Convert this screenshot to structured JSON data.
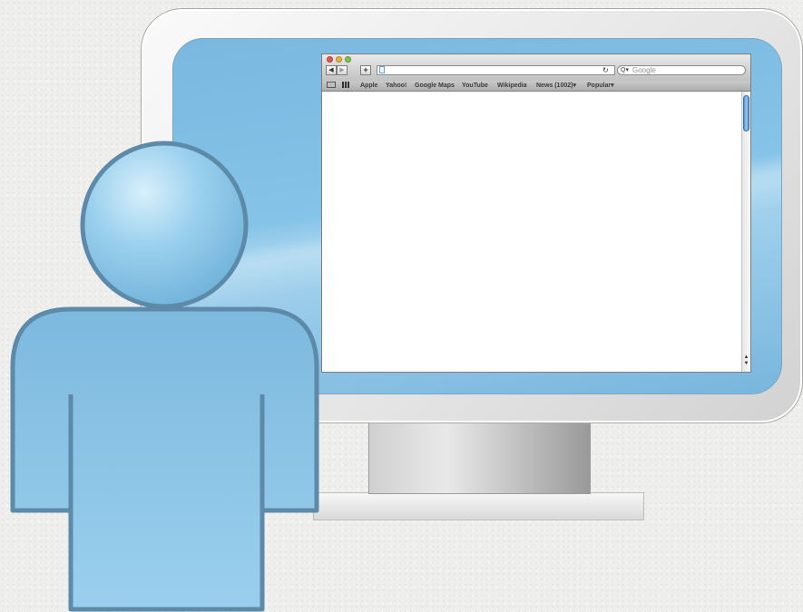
{
  "browser": {
    "search_placeholder": "Google",
    "bookmarks": [
      "Apple",
      "Yahoo!",
      "Google Maps",
      "YouTube",
      "Wikipedia",
      "News (1002)",
      "Popular"
    ],
    "dropdown_marker": "▾",
    "back_glyph": "◀",
    "forward_glyph": "▶",
    "add_glyph": "+",
    "reload_glyph": "↻",
    "search_glyph": "Q▾"
  },
  "colors": {
    "screen_blue": "#7ab8e0",
    "person_fill": "#8ec6e6",
    "person_stroke": "#5d8aa8",
    "bezel": "#e4e4e4"
  },
  "icons": [
    "reading-list-icon",
    "top-sites-icon",
    "page-icon",
    "reload-icon",
    "search-icon",
    "user-icon"
  ]
}
